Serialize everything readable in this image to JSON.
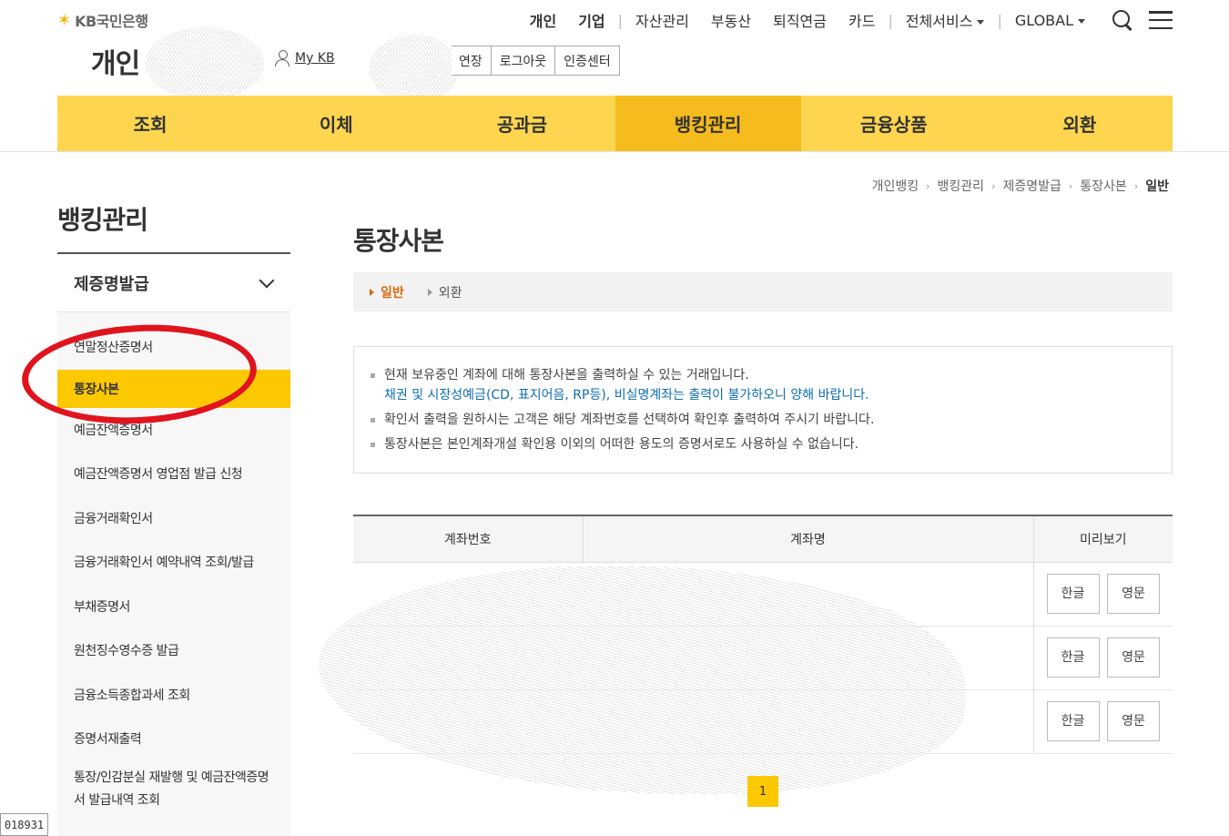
{
  "header": {
    "logo_mark": "✶",
    "logo_text": "KB국민은행",
    "section_title": "개인",
    "mykb_label": "My KB",
    "session_buttons": [
      "연장",
      "로그아웃",
      "인증센터"
    ],
    "top_nav": [
      "개인",
      "기업",
      "자산관리",
      "부동산",
      "퇴직연금",
      "카드",
      "전체서비스",
      "GLOBAL"
    ],
    "icons": [
      "search-icon",
      "menu-icon",
      "user-icon"
    ]
  },
  "gnb": {
    "items": [
      "조회",
      "이체",
      "공과금",
      "뱅킹관리",
      "금융상품",
      "외환"
    ],
    "active": "뱅킹관리",
    "color": "#fdd54f",
    "active_color": "#f6bb1c"
  },
  "breadcrumb": [
    "개인뱅킹",
    "뱅킹관리",
    "제증명발급",
    "통장사본",
    "일반"
  ],
  "sidebar": {
    "title": "뱅킹관리",
    "group": "제증명발급",
    "items": [
      "연말정산증명서",
      "통장사본",
      "예금잔액증명서",
      "예금잔액증명서 영업점 발급 신청",
      "금융거래확인서",
      "금융거래확인서 예약내역 조회/발급",
      "부채증명서",
      "원천징수영수증 발급",
      "금융소득종합과세 조회",
      "증명서재출력",
      "통장/인감분실 재발행 및 예금잔액증명서 발급내역 조회"
    ],
    "active": "통장사본",
    "active_color": "#fcc800"
  },
  "main": {
    "title": "통장사본",
    "tabs": [
      "일반",
      "외환"
    ],
    "notice": {
      "line1": "현재 보유중인 계좌에 대해 통장사본을 출력하실 수 있는 거래입니다.",
      "line1_sub": "채권 및 시장성예금(CD, 표지어음, RP등), 비실명계좌는 출력이 불가하오니 양해 바랍니다.",
      "line2": "확인서 출력을 원하시는 고객은 해당 계좌번호를 선택하여 확인후 출력하여 주시기 바랍니다.",
      "line3": "통장사본은 본인계좌개설 확인용 이외의 어떠한 용도의 증명서로도 사용하실 수 없습니다."
    },
    "table": {
      "headers": [
        "계좌번호",
        "계좌명",
        "미리보기"
      ],
      "preview_buttons": [
        "한글",
        "영문"
      ]
    },
    "pagination": [
      "1"
    ]
  },
  "corner_tag": "018931"
}
